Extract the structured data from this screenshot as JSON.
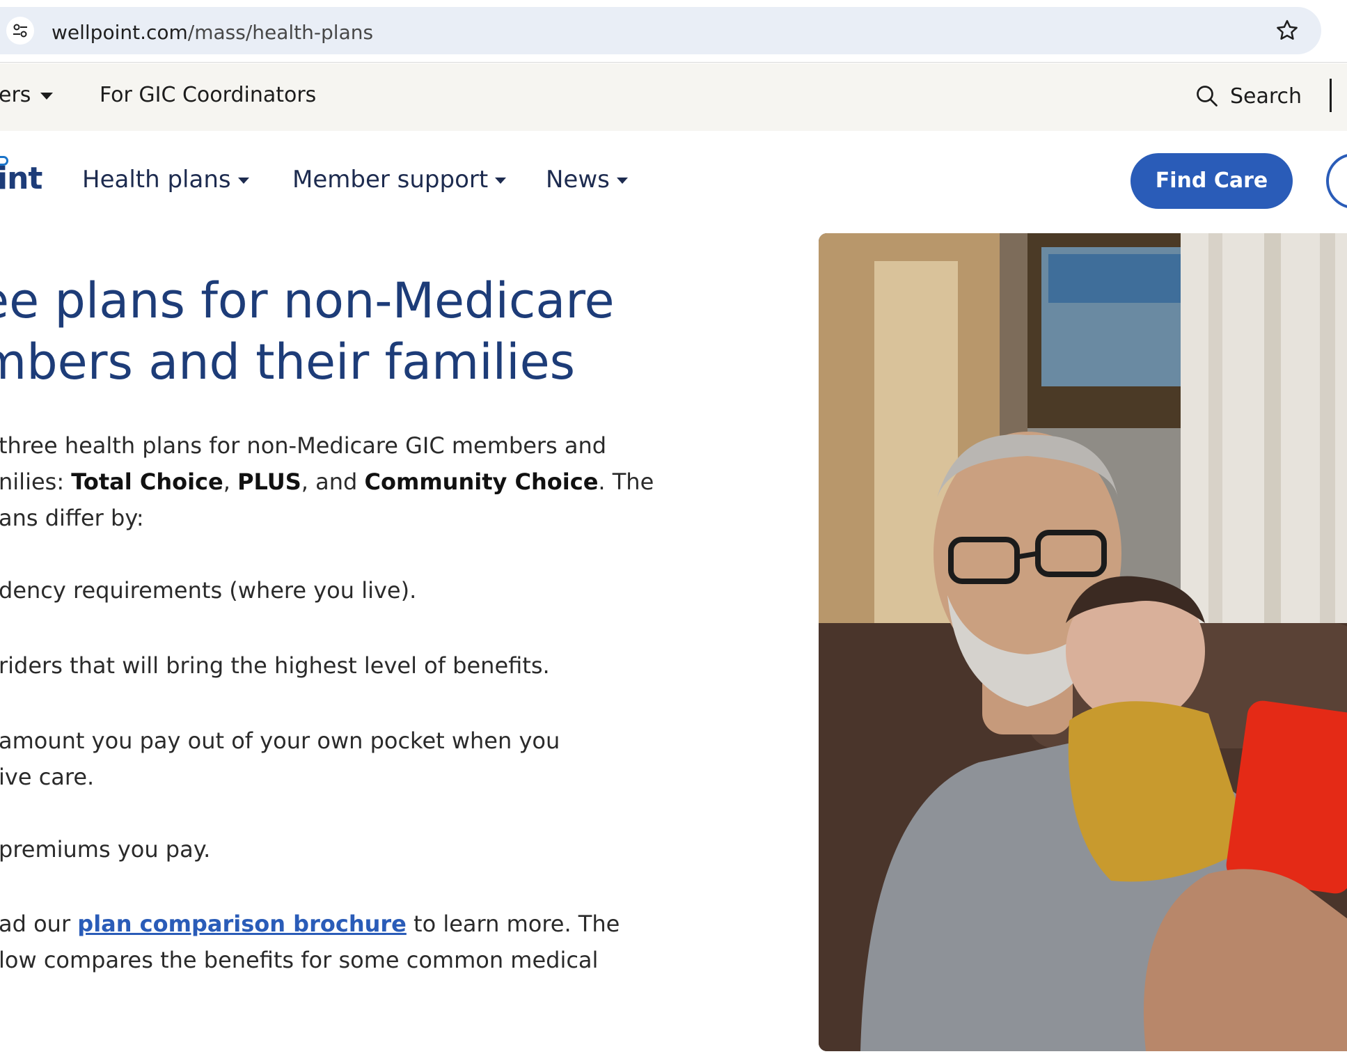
{
  "browser": {
    "url_host": "wellpoint.com",
    "url_path": "/mass/health-plans"
  },
  "utility_bar": {
    "members_fragment": "ers",
    "gic_coordinators": "For GIC Coordinators",
    "search": "Search"
  },
  "main_nav": {
    "logo_fragment": "int",
    "health_plans": "Health plans",
    "member_support": "Member support",
    "news": "News",
    "find_care": "Find Care"
  },
  "hero": {
    "title_line1": "ee plans for non-Medicare",
    "title_line2": "mbers and their families",
    "intro_line1": " three health plans for non-Medicare GIC members and",
    "intro_line2_start": "nilies: ",
    "plan_1": "Total Choice",
    "sep_1": ", ",
    "plan_2": "PLUS",
    "sep_2": ", and ",
    "plan_3": "Community Choice",
    "intro_line2_end": ". The",
    "intro_line3": "ans differ by:",
    "bullet_1": "dency requirements (where you live).",
    "bullet_2": "riders that will bring the highest level of benefits.",
    "bullet_3_line1": "amount you pay out of your own pocket when you",
    "bullet_3_line2": "ive care.",
    "bullet_4": "premiums you pay.",
    "cta_line1_start": "ad our ",
    "cta_link": "plan comparison brochure",
    "cta_line1_end": " to learn more. The",
    "cta_line2": "low compares the benefits for some common medical"
  },
  "colors": {
    "brand_navy": "#1d3c78",
    "button_blue": "#2a5cb8",
    "utility_bg": "#f6f5f1",
    "omnibox_bg": "#e9eef6"
  },
  "icons": {
    "site_info": "tune-icon",
    "bookmark": "star-icon",
    "search": "search-icon"
  }
}
